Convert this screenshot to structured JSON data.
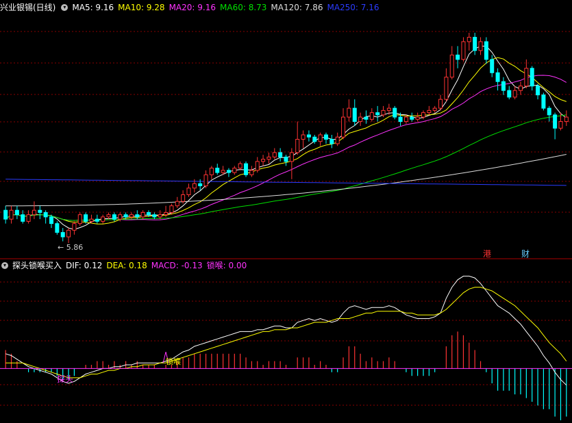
{
  "main_header": {
    "title": "兴业银锡(日线)",
    "ma": [
      {
        "label": "MA5: 9.16",
        "color": "#ffffff"
      },
      {
        "label": "MA10: 9.28",
        "color": "#ffff00"
      },
      {
        "label": "MA20: 9.16",
        "color": "#ff33ff"
      },
      {
        "label": "MA60: 8.73",
        "color": "#00e000"
      },
      {
        "label": "MA120: 7.86",
        "color": "#dddddd"
      },
      {
        "label": "MA250: 7.16",
        "color": "#2b3cff"
      }
    ]
  },
  "sub_header": {
    "title": "探头锁喉买入",
    "items": [
      {
        "label": "DIF: 0.12",
        "color": "#ffffff"
      },
      {
        "label": "DEA: 0.18",
        "color": "#ffff00"
      },
      {
        "label": "MACD: -0.13",
        "color": "#ff33ff"
      },
      {
        "label": "锁喉: 0.00",
        "color": "#ff33ff"
      }
    ]
  },
  "badges": {
    "gang": "港",
    "cai": "财"
  },
  "annotations": {
    "low_price": "← 5.86",
    "tantou": "探头",
    "suohou": "锁喉"
  },
  "colors": {
    "up": "#ff3333",
    "down": "#00ffff",
    "grid": "#8b0000",
    "border": "#aa0000"
  },
  "chart_data": [
    {
      "type": "candlestick",
      "title": "兴业银锡(日线)",
      "y_range": [
        5.6,
        11.0
      ],
      "grid": true,
      "series_lines": [
        "MA5",
        "MA10",
        "MA20",
        "MA60",
        "MA120",
        "MA250"
      ],
      "candles": [
        [
          6.6,
          6.4,
          6.7,
          6.3
        ],
        [
          6.4,
          6.6,
          6.7,
          6.3
        ],
        [
          6.6,
          6.5,
          6.7,
          6.4
        ],
        [
          6.5,
          6.35,
          6.6,
          6.3
        ],
        [
          6.35,
          6.5,
          6.6,
          6.3
        ],
        [
          6.5,
          6.6,
          6.8,
          6.4
        ],
        [
          6.6,
          6.55,
          6.7,
          6.4
        ],
        [
          6.55,
          6.45,
          6.6,
          6.3
        ],
        [
          6.45,
          6.3,
          6.5,
          6.2
        ],
        [
          6.3,
          6.1,
          6.35,
          6.05
        ],
        [
          6.1,
          6.0,
          6.2,
          5.9
        ],
        [
          6.0,
          6.15,
          6.2,
          5.86
        ],
        [
          6.15,
          6.3,
          6.35,
          6.05
        ],
        [
          6.3,
          6.5,
          6.55,
          6.25
        ],
        [
          6.5,
          6.35,
          6.55,
          6.3
        ],
        [
          6.35,
          6.4,
          6.5,
          6.3
        ],
        [
          6.4,
          6.35,
          6.5,
          6.3
        ],
        [
          6.35,
          6.45,
          6.5,
          6.3
        ],
        [
          6.45,
          6.5,
          6.55,
          6.4
        ],
        [
          6.5,
          6.4,
          6.55,
          6.35
        ],
        [
          6.4,
          6.5,
          6.55,
          6.35
        ],
        [
          6.5,
          6.45,
          6.55,
          6.4
        ],
        [
          6.45,
          6.5,
          6.55,
          6.4
        ],
        [
          6.5,
          6.45,
          6.6,
          6.4
        ],
        [
          6.45,
          6.55,
          6.6,
          6.4
        ],
        [
          6.55,
          6.5,
          6.6,
          6.45
        ],
        [
          6.5,
          6.45,
          6.55,
          6.4
        ],
        [
          6.45,
          6.5,
          6.6,
          6.4
        ],
        [
          6.5,
          6.55,
          6.7,
          6.45
        ],
        [
          6.55,
          6.7,
          6.75,
          6.5
        ],
        [
          6.7,
          6.8,
          6.9,
          6.65
        ],
        [
          6.8,
          6.95,
          7.05,
          6.75
        ],
        [
          6.95,
          7.1,
          7.2,
          6.9
        ],
        [
          7.1,
          7.2,
          7.3,
          7.0
        ],
        [
          7.2,
          7.15,
          7.3,
          7.05
        ],
        [
          7.15,
          7.4,
          7.5,
          7.1
        ],
        [
          7.4,
          7.55,
          7.6,
          7.3
        ],
        [
          7.55,
          7.45,
          7.65,
          7.4
        ],
        [
          7.45,
          7.5,
          7.6,
          7.4
        ],
        [
          7.5,
          7.45,
          7.55,
          7.35
        ],
        [
          7.45,
          7.55,
          7.6,
          7.4
        ],
        [
          7.55,
          7.65,
          7.7,
          7.5
        ],
        [
          7.65,
          7.4,
          7.7,
          7.35
        ],
        [
          7.4,
          7.5,
          7.6,
          7.35
        ],
        [
          7.5,
          7.7,
          7.8,
          7.45
        ],
        [
          7.7,
          7.75,
          7.85,
          7.6
        ],
        [
          7.75,
          7.8,
          7.9,
          7.65
        ],
        [
          7.8,
          7.9,
          8.0,
          7.75
        ],
        [
          7.9,
          7.8,
          8.0,
          7.7
        ],
        [
          7.8,
          7.7,
          7.85,
          7.6
        ],
        [
          7.7,
          7.9,
          8.0,
          7.3
        ],
        [
          7.9,
          8.2,
          8.6,
          7.85
        ],
        [
          8.2,
          8.3,
          8.4,
          8.0
        ],
        [
          8.3,
          8.25,
          8.4,
          8.15
        ],
        [
          8.25,
          8.15,
          8.3,
          8.1
        ],
        [
          8.15,
          8.3,
          8.35,
          8.05
        ],
        [
          8.3,
          8.2,
          8.35,
          8.1
        ],
        [
          8.2,
          8.1,
          8.3,
          8.0
        ],
        [
          8.1,
          8.25,
          8.35,
          8.05
        ],
        [
          8.25,
          8.7,
          8.9,
          8.2
        ],
        [
          8.7,
          8.9,
          9.1,
          8.6
        ],
        [
          8.9,
          8.6,
          9.1,
          8.5
        ],
        [
          8.6,
          8.7,
          8.8,
          8.5
        ],
        [
          8.7,
          8.65,
          8.85,
          8.55
        ],
        [
          8.65,
          8.8,
          8.9,
          8.6
        ],
        [
          8.8,
          8.75,
          8.95,
          8.6
        ],
        [
          8.75,
          8.85,
          8.95,
          8.7
        ],
        [
          8.85,
          8.9,
          9.0,
          8.75
        ],
        [
          8.9,
          8.7,
          8.95,
          8.65
        ],
        [
          8.7,
          8.6,
          8.8,
          8.5
        ],
        [
          8.6,
          8.7,
          8.75,
          8.55
        ],
        [
          8.7,
          8.65,
          8.8,
          8.6
        ],
        [
          8.65,
          8.7,
          8.8,
          8.6
        ],
        [
          8.7,
          8.8,
          8.85,
          8.65
        ],
        [
          8.8,
          8.85,
          8.95,
          8.75
        ],
        [
          8.85,
          8.9,
          8.95,
          8.8
        ],
        [
          8.9,
          9.1,
          9.2,
          8.85
        ],
        [
          9.1,
          9.6,
          9.8,
          9.05
        ],
        [
          9.6,
          10.1,
          10.3,
          9.55
        ],
        [
          10.1,
          10.0,
          10.3,
          9.8
        ],
        [
          10.0,
          10.4,
          10.5,
          9.95
        ],
        [
          10.4,
          10.5,
          10.6,
          10.2
        ],
        [
          10.5,
          10.2,
          10.6,
          10.1
        ],
        [
          10.2,
          10.4,
          10.5,
          10.1
        ],
        [
          10.4,
          10.0,
          10.5,
          9.9
        ],
        [
          10.0,
          9.7,
          10.1,
          9.6
        ],
        [
          9.7,
          9.5,
          9.8,
          9.3
        ],
        [
          9.5,
          9.3,
          9.6,
          9.2
        ],
        [
          9.3,
          9.15,
          9.4,
          9.1
        ],
        [
          9.15,
          9.3,
          9.4,
          9.1
        ],
        [
          9.3,
          9.4,
          9.5,
          9.2
        ],
        [
          9.4,
          9.8,
          10.0,
          9.35
        ],
        [
          9.8,
          9.4,
          9.85,
          9.3
        ],
        [
          9.4,
          9.2,
          9.45,
          9.1
        ],
        [
          9.2,
          8.9,
          9.25,
          8.85
        ],
        [
          8.9,
          8.75,
          8.95,
          8.6
        ],
        [
          8.75,
          8.45,
          8.8,
          8.2
        ],
        [
          8.45,
          8.6,
          8.8,
          8.4
        ],
        [
          8.6,
          8.7,
          8.85,
          8.5
        ]
      ]
    },
    {
      "type": "macd",
      "title": "探头锁喉买入",
      "y_range": [
        -0.28,
        0.52
      ],
      "grid": true,
      "series_lines": [
        "DIF",
        "DEA"
      ],
      "dif": [
        0.08,
        0.07,
        0.05,
        0.03,
        0.01,
        0.0,
        -0.01,
        -0.02,
        -0.03,
        -0.05,
        -0.07,
        -0.08,
        -0.07,
        -0.05,
        -0.03,
        -0.02,
        -0.01,
        0.0,
        0.0,
        0.01,
        0.01,
        0.02,
        0.02,
        0.03,
        0.03,
        0.03,
        0.03,
        0.03,
        0.04,
        0.05,
        0.07,
        0.09,
        0.1,
        0.12,
        0.13,
        0.14,
        0.15,
        0.16,
        0.17,
        0.18,
        0.19,
        0.2,
        0.2,
        0.2,
        0.21,
        0.21,
        0.22,
        0.23,
        0.23,
        0.22,
        0.22,
        0.25,
        0.26,
        0.27,
        0.26,
        0.27,
        0.26,
        0.25,
        0.26,
        0.3,
        0.33,
        0.34,
        0.33,
        0.32,
        0.33,
        0.33,
        0.33,
        0.34,
        0.33,
        0.31,
        0.29,
        0.28,
        0.27,
        0.27,
        0.27,
        0.28,
        0.3,
        0.38,
        0.44,
        0.48,
        0.5,
        0.5,
        0.49,
        0.46,
        0.42,
        0.38,
        0.34,
        0.32,
        0.3,
        0.27,
        0.24,
        0.2,
        0.16,
        0.12,
        0.07,
        0.03,
        -0.02,
        -0.06,
        -0.09
      ],
      "dea": [
        0.03,
        0.03,
        0.03,
        0.03,
        0.02,
        0.01,
        0.0,
        -0.01,
        -0.02,
        -0.03,
        -0.04,
        -0.05,
        -0.05,
        -0.05,
        -0.04,
        -0.03,
        -0.03,
        -0.02,
        -0.01,
        -0.01,
        0.0,
        0.0,
        0.01,
        0.01,
        0.02,
        0.02,
        0.02,
        0.03,
        0.03,
        0.04,
        0.05,
        0.06,
        0.07,
        0.08,
        0.09,
        0.1,
        0.11,
        0.12,
        0.13,
        0.14,
        0.15,
        0.16,
        0.17,
        0.18,
        0.19,
        0.2,
        0.2,
        0.21,
        0.21,
        0.21,
        0.22,
        0.22,
        0.23,
        0.24,
        0.25,
        0.25,
        0.25,
        0.26,
        0.27,
        0.27,
        0.27,
        0.28,
        0.29,
        0.3,
        0.3,
        0.31,
        0.31,
        0.31,
        0.31,
        0.31,
        0.3,
        0.3,
        0.29,
        0.29,
        0.29,
        0.29,
        0.3,
        0.32,
        0.35,
        0.38,
        0.41,
        0.43,
        0.44,
        0.44,
        0.43,
        0.42,
        0.4,
        0.38,
        0.36,
        0.34,
        0.31,
        0.28,
        0.25,
        0.22,
        0.18,
        0.14,
        0.11,
        0.08,
        0.04
      ]
    }
  ]
}
